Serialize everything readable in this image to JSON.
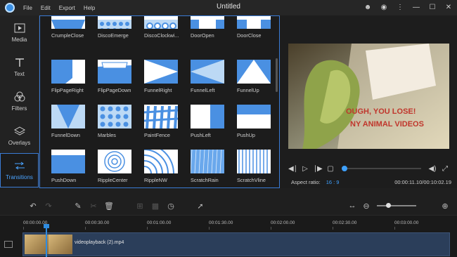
{
  "window": {
    "title": "Untitled"
  },
  "menu": [
    "File",
    "Edit",
    "Export",
    "Help"
  ],
  "title_icons": [
    "user-icon",
    "record-icon",
    "more-icon",
    "minimize-icon",
    "maximize-icon",
    "close-icon"
  ],
  "rail": [
    {
      "label": "Media",
      "icon": "media-icon",
      "active": false
    },
    {
      "label": "Text",
      "icon": "text-icon",
      "active": false
    },
    {
      "label": "Filters",
      "icon": "filters-icon",
      "active": false
    },
    {
      "label": "Overlays",
      "icon": "overlays-icon",
      "active": false
    },
    {
      "label": "Transitions",
      "icon": "transitions-icon",
      "active": true
    }
  ],
  "transitions": [
    "CrumpleClose",
    "DiscoEmerge",
    "DiscoClockwi...",
    "DoorOpen",
    "DoorClose",
    "FlipPageRight",
    "FlipPageDown",
    "FunnelRight",
    "FunnelLeft",
    "FunnelUp",
    "FunnelDown",
    "Marbles",
    "PaintFence",
    "PushLeft",
    "PushUp",
    "PushDown",
    "RippleCenter",
    "RippleNW",
    "ScratchRain",
    "ScratchVline"
  ],
  "preview": {
    "aspect_label": "Aspect ratio:",
    "aspect_value": "16 : 9",
    "time_current": "00:00:11.10",
    "time_total": "00:10:02.19",
    "time_sep": "/",
    "progress": 0.0,
    "video_text_1": "OUGH, YOU LOSE!",
    "video_text_2": "NY ANIMAL VIDEOS"
  },
  "timeline": {
    "ticks": [
      "00:00:00.00",
      "00:00:30.00",
      "00:01:00.00",
      "00:01:30.00",
      "00:02:00.00",
      "00:02:30.00",
      "00:03:00.00"
    ],
    "clip_name": "videoplayback (2).mp4"
  },
  "colors": {
    "accent": "#3ea1ff",
    "tile_blue": "#4a90e2",
    "tile_light": "#bcd9f5"
  }
}
